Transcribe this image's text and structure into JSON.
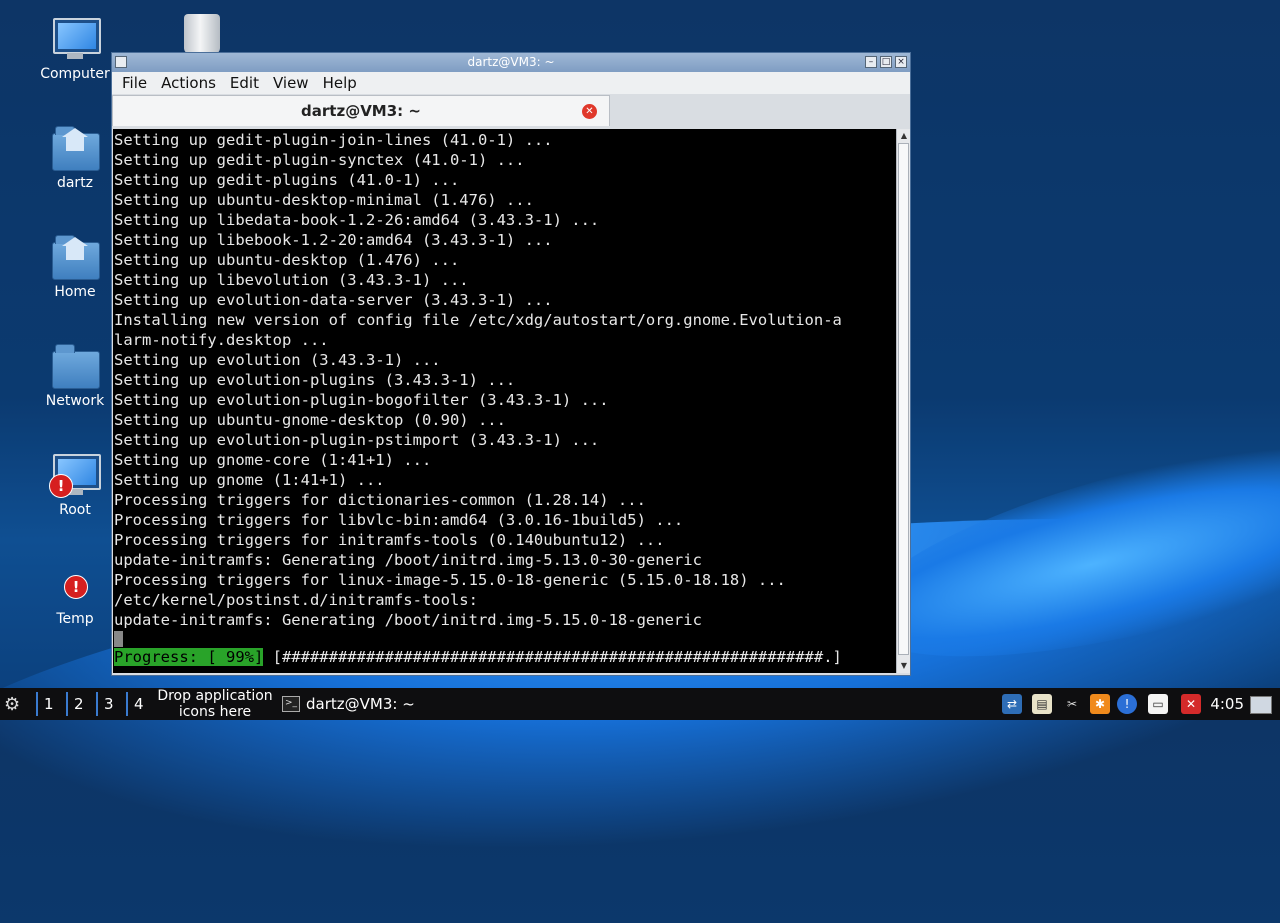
{
  "desktop": {
    "icons": [
      {
        "label": "Computer"
      },
      {
        "label": "dartz"
      },
      {
        "label": "Home"
      },
      {
        "label": "Network"
      },
      {
        "label": "Root"
      },
      {
        "label": "Temp"
      }
    ]
  },
  "window": {
    "title": "dartz@VM3: ~",
    "menu": [
      "File",
      "Actions",
      "Edit",
      "View",
      "Help"
    ],
    "tab_title": "dartz@VM3: ~",
    "terminal_lines": [
      "Setting up gedit-plugin-join-lines (41.0-1) ...",
      "Setting up gedit-plugin-synctex (41.0-1) ...",
      "Setting up gedit-plugins (41.0-1) ...",
      "Setting up ubuntu-desktop-minimal (1.476) ...",
      "Setting up libedata-book-1.2-26:amd64 (3.43.3-1) ...",
      "Setting up libebook-1.2-20:amd64 (3.43.3-1) ...",
      "Setting up ubuntu-desktop (1.476) ...",
      "Setting up libevolution (3.43.3-1) ...",
      "Setting up evolution-data-server (3.43.3-1) ...",
      "Installing new version of config file /etc/xdg/autostart/org.gnome.Evolution-a",
      "larm-notify.desktop ...",
      "Setting up evolution (3.43.3-1) ...",
      "Setting up evolution-plugins (3.43.3-1) ...",
      "Setting up evolution-plugin-bogofilter (3.43.3-1) ...",
      "Setting up ubuntu-gnome-desktop (0.90) ...",
      "Setting up evolution-plugin-pstimport (3.43.3-1) ...",
      "Setting up gnome-core (1:41+1) ...",
      "Setting up gnome (1:41+1) ...",
      "Processing triggers for dictionaries-common (1.28.14) ...",
      "Processing triggers for libvlc-bin:amd64 (3.0.16-1build5) ...",
      "Processing triggers for initramfs-tools (0.140ubuntu12) ...",
      "update-initramfs: Generating /boot/initrd.img-5.13.0-30-generic",
      "Processing triggers for linux-image-5.15.0-18-generic (5.15.0-18.18) ...",
      "/etc/kernel/postinst.d/initramfs-tools:",
      "update-initramfs: Generating /boot/initrd.img-5.15.0-18-generic"
    ],
    "progress_label": "Progress: [ 99%]",
    "progress_bar": " [##########################################################.]",
    "progress_percent": 99
  },
  "taskbar": {
    "workspaces": [
      "1",
      "2",
      "3",
      "4"
    ],
    "drop_hint_line1": "Drop application",
    "drop_hint_line2": "icons here",
    "task_title": "dartz@VM3: ~",
    "clock": "4:05"
  }
}
